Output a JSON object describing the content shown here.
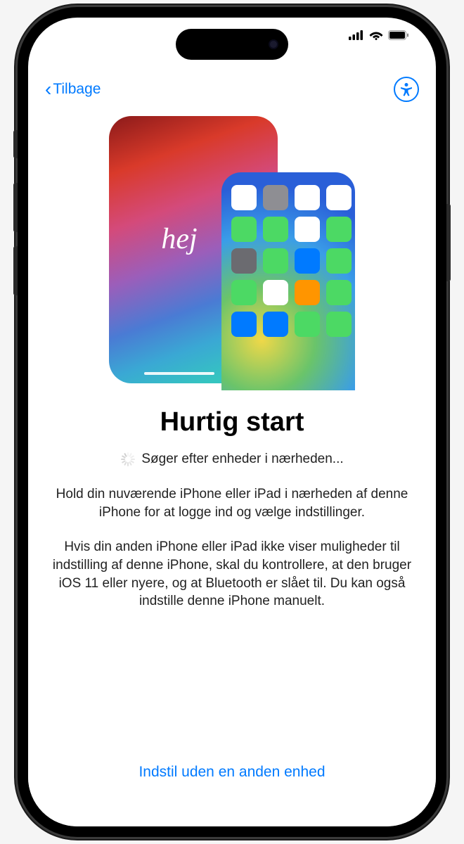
{
  "nav": {
    "back_label": "Tilbage"
  },
  "hero": {
    "greeting": "hej"
  },
  "content": {
    "title": "Hurtig start",
    "searching": "Søger efter enheder i nærheden...",
    "para1": "Hold din nuværende iPhone eller iPad i nærheden af denne iPhone for at logge ind og vælge indstillinger.",
    "para2": "Hvis din anden iPhone eller iPad ikke viser muligheder til indstilling af denne iPhone, skal du kontrollere, at den bruger iOS 11 eller nyere, og at Bluetooth er slået til. Du kan også indstille denne iPhone manuelt."
  },
  "footer": {
    "setup_without": "Indstil uden en anden enhed"
  },
  "app_colors": [
    "#ffffff",
    "#8e8e93",
    "#ffffff",
    "#ffffff",
    "#4cd964",
    "#4cd964",
    "#ffffff",
    "#4cd964",
    "#6b6b70",
    "#4cd964",
    "#007aff",
    "#4cd964",
    "#4cd964",
    "#ffffff",
    "#ff9500",
    "#4cd964",
    "#007aff",
    "#007aff",
    "#4cd964",
    "#4cd964"
  ]
}
